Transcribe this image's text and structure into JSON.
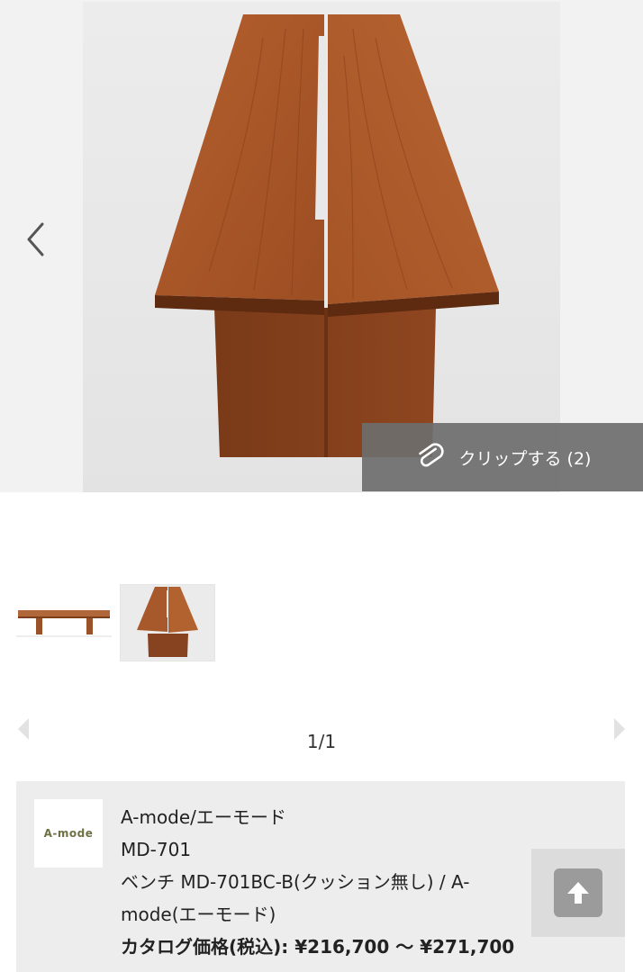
{
  "gallery": {
    "main_image_alt": "ベンチ MD-701 木製天板",
    "clip_label": "クリップする (2)",
    "thumbnails": [
      {
        "alt": "ベンチ 側面"
      },
      {
        "alt": "ベンチ 天板"
      }
    ],
    "page_counter": "1/1"
  },
  "product": {
    "brand_logo_text": "A-mode",
    "brand_line": "A-mode/エーモード",
    "model": "MD-701",
    "name_line1": "ベンチ MD-701BC-B(クッション無し) / A-",
    "name_line2": "mode(エーモード)",
    "price": "カタログ価格(税込): ¥216,700 〜 ¥271,700"
  },
  "colors": {
    "wood": "#a0522d",
    "overlay": "#6e6e6e",
    "card_bg": "#ededed",
    "logo_text": "#6f7044"
  },
  "icons": {
    "prev": "chevron-left-icon",
    "clip": "paperclip-icon",
    "carousel_prev": "triangle-left-icon",
    "carousel_next": "triangle-right-icon",
    "scroll_top": "arrow-up-icon"
  }
}
